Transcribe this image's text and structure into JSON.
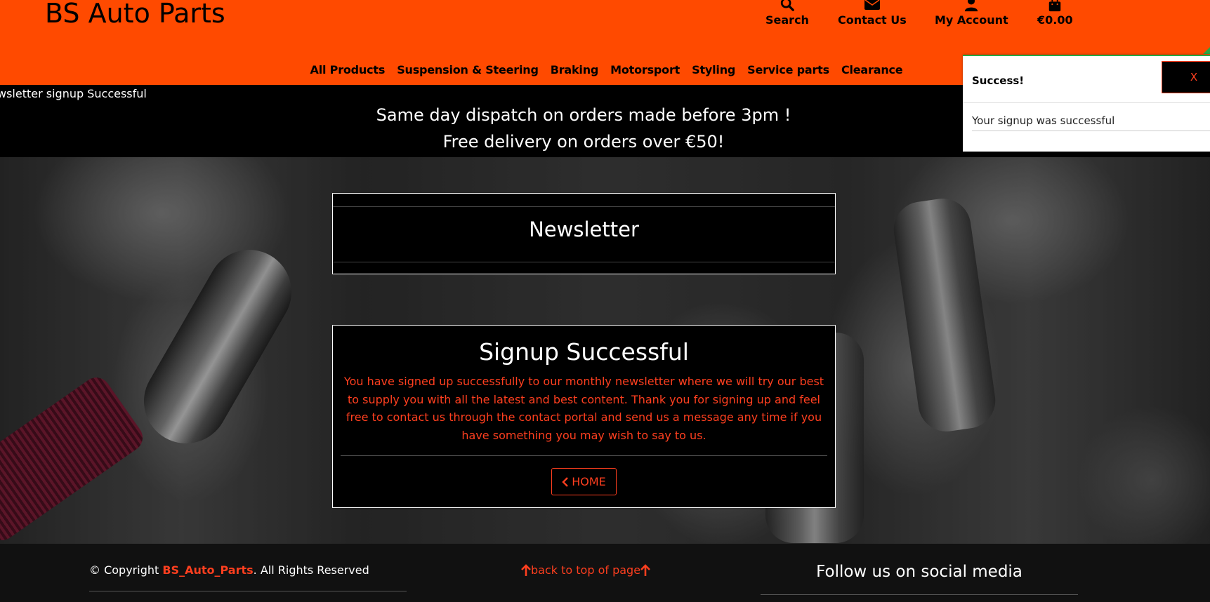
{
  "header": {
    "brand": "BS Auto Parts",
    "utilities": [
      {
        "label": "Search",
        "icon": "search-icon"
      },
      {
        "label": "Contact Us",
        "icon": "envelope-icon"
      },
      {
        "label": "My Account",
        "icon": "user-icon"
      },
      {
        "label": "€0.00",
        "icon": "shopping-bag-icon"
      }
    ],
    "nav": [
      "All Products",
      "Suspension & Steering",
      "Braking",
      "Motorsport",
      "Styling",
      "Service parts",
      "Clearance"
    ],
    "flash_message": "wsletter signup Successful"
  },
  "promo": {
    "line1": "Same day dispatch on orders made before 3pm !",
    "line2": "Free delivery on orders over €50!"
  },
  "newsletter": {
    "title": "Newsletter"
  },
  "signup": {
    "title": "Signup Successful",
    "text": "You have signed up successfully to our monthly newsletter where we will try our best to supply you with all the latest and best content. Thank you for signing up and feel free to contact us through the contact portal and send us a message any time if you have something you may wish to say to us.",
    "home_label": "HOME"
  },
  "footer": {
    "copyright_prefix": "© Copyright ",
    "copyright_brand": "BS_Auto_Parts",
    "copyright_suffix": ". All Rights Reserved",
    "back_to_top": "back to top of page",
    "social_title": "Follow us on social media"
  },
  "toast": {
    "heading": "Success!",
    "close_label": "X",
    "body": "Your signup was successful"
  },
  "colors": {
    "header_bg": "#ff4a00",
    "accent": "#ff3f1f",
    "toast_border": "#28a745"
  }
}
